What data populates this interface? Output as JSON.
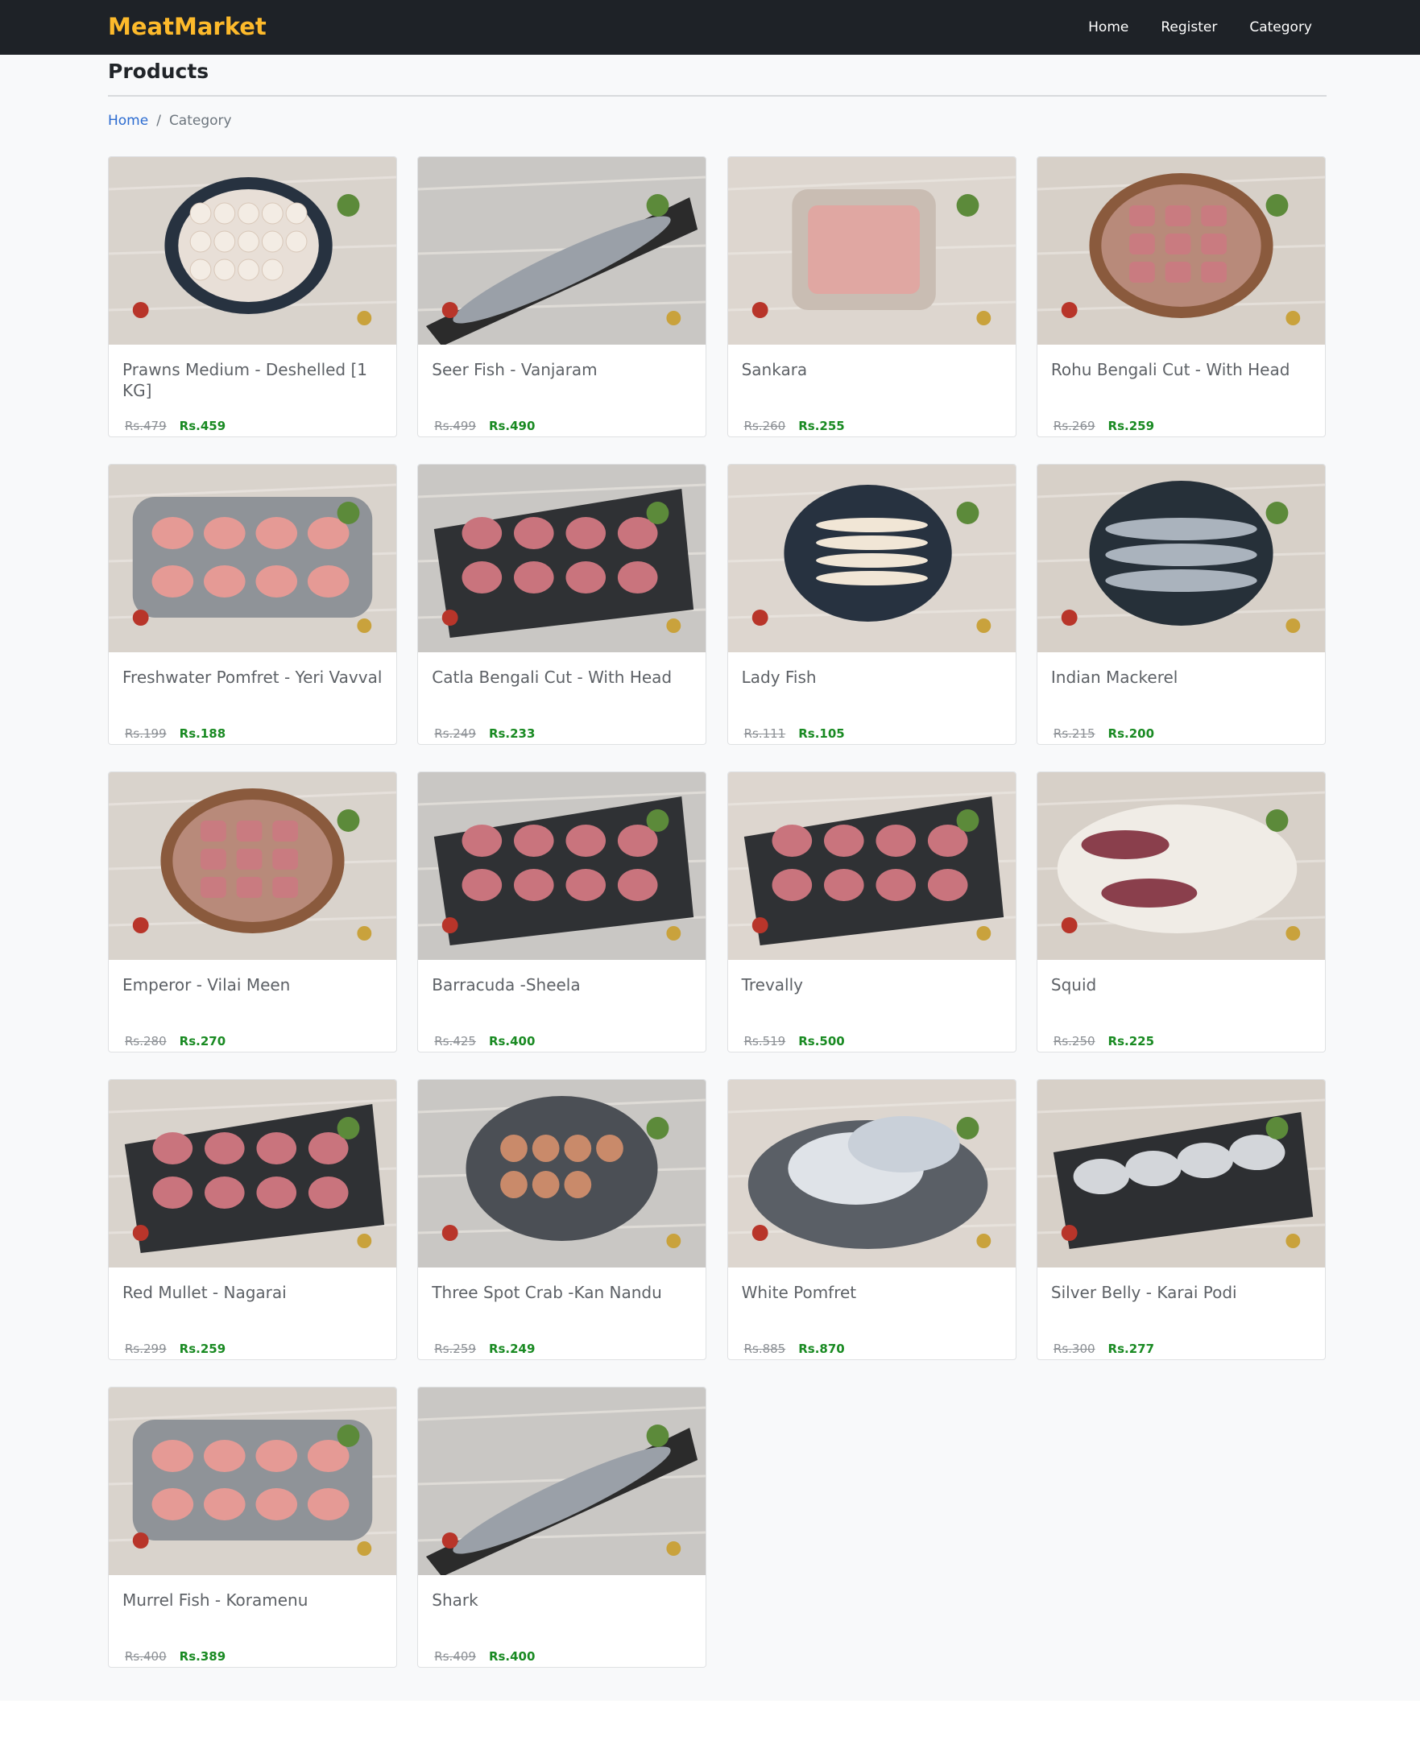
{
  "nav": {
    "brand": "MeatMarket",
    "links": [
      "Home",
      "Register",
      "Category"
    ]
  },
  "page": {
    "title": "Products",
    "breadcrumb": {
      "home": "Home",
      "separator": "/",
      "current": "Category"
    }
  },
  "colors": {
    "navbar_bg": "#1e2227",
    "brand": "#fdba2b",
    "link": "#2b6bd0",
    "price_new": "#198a22",
    "price_old": "#8c9095"
  },
  "products": [
    {
      "name": "Prawns Medium - Deshelled [1 KG]",
      "old_price": "Rs.479",
      "price": "Rs.459",
      "photo": "prawns-plate-photo"
    },
    {
      "name": "Seer Fish - Vanjaram",
      "old_price": "Rs.499",
      "price": "Rs.490",
      "photo": "whole-fish-photo"
    },
    {
      "name": "Sankara",
      "old_price": "Rs.260",
      "price": "Rs.255",
      "photo": "fish-in-dish-photo"
    },
    {
      "name": "Rohu Bengali Cut - With Head",
      "old_price": "Rs.269",
      "price": "Rs.259",
      "photo": "fish-pieces-bowl-photo"
    },
    {
      "name": "Freshwater Pomfret - Yeri Vavval",
      "old_price": "Rs.199",
      "price": "Rs.188",
      "photo": "fish-steaks-tray-photo"
    },
    {
      "name": "Catla Bengali Cut - With Head",
      "old_price": "Rs.249",
      "price": "Rs.233",
      "photo": "fish-pieces-slate-photo"
    },
    {
      "name": "Lady Fish",
      "old_price": "Rs.111",
      "price": "Rs.105",
      "photo": "fish-plate-photo"
    },
    {
      "name": "Indian Mackerel",
      "old_price": "Rs.215",
      "price": "Rs.200",
      "photo": "mackerel-plate-photo"
    },
    {
      "name": "Emperor - Vilai Meen",
      "old_price": "Rs.280",
      "price": "Rs.270",
      "photo": "fish-pieces-bowl-photo"
    },
    {
      "name": "Barracuda -Sheela",
      "old_price": "Rs.425",
      "price": "Rs.400",
      "photo": "fish-steaks-slate-photo"
    },
    {
      "name": "Trevally",
      "old_price": "Rs.519",
      "price": "Rs.500",
      "photo": "fish-steaks-slate-photo"
    },
    {
      "name": "Squid",
      "old_price": "Rs.250",
      "price": "Rs.225",
      "photo": "squid-board-photo"
    },
    {
      "name": "Red Mullet - Nagarai",
      "old_price": "Rs.299",
      "price": "Rs.259",
      "photo": "fish-pieces-slate-photo"
    },
    {
      "name": "Three Spot Crab -Kan Nandu",
      "old_price": "Rs.259",
      "price": "Rs.249",
      "photo": "crab-plate-photo"
    },
    {
      "name": "White Pomfret",
      "old_price": "Rs.885",
      "price": "Rs.870",
      "photo": "pomfret-board-photo"
    },
    {
      "name": "Silver Belly - Karai Podi",
      "old_price": "Rs.300",
      "price": "Rs.277",
      "photo": "small-fish-slate-photo"
    },
    {
      "name": "Murrel Fish - Koramenu",
      "old_price": "Rs.400",
      "price": "Rs.389",
      "photo": "fish-steaks-tray-photo"
    },
    {
      "name": "Shark",
      "old_price": "Rs.409",
      "price": "Rs.400",
      "photo": "whole-fish-photo"
    }
  ]
}
